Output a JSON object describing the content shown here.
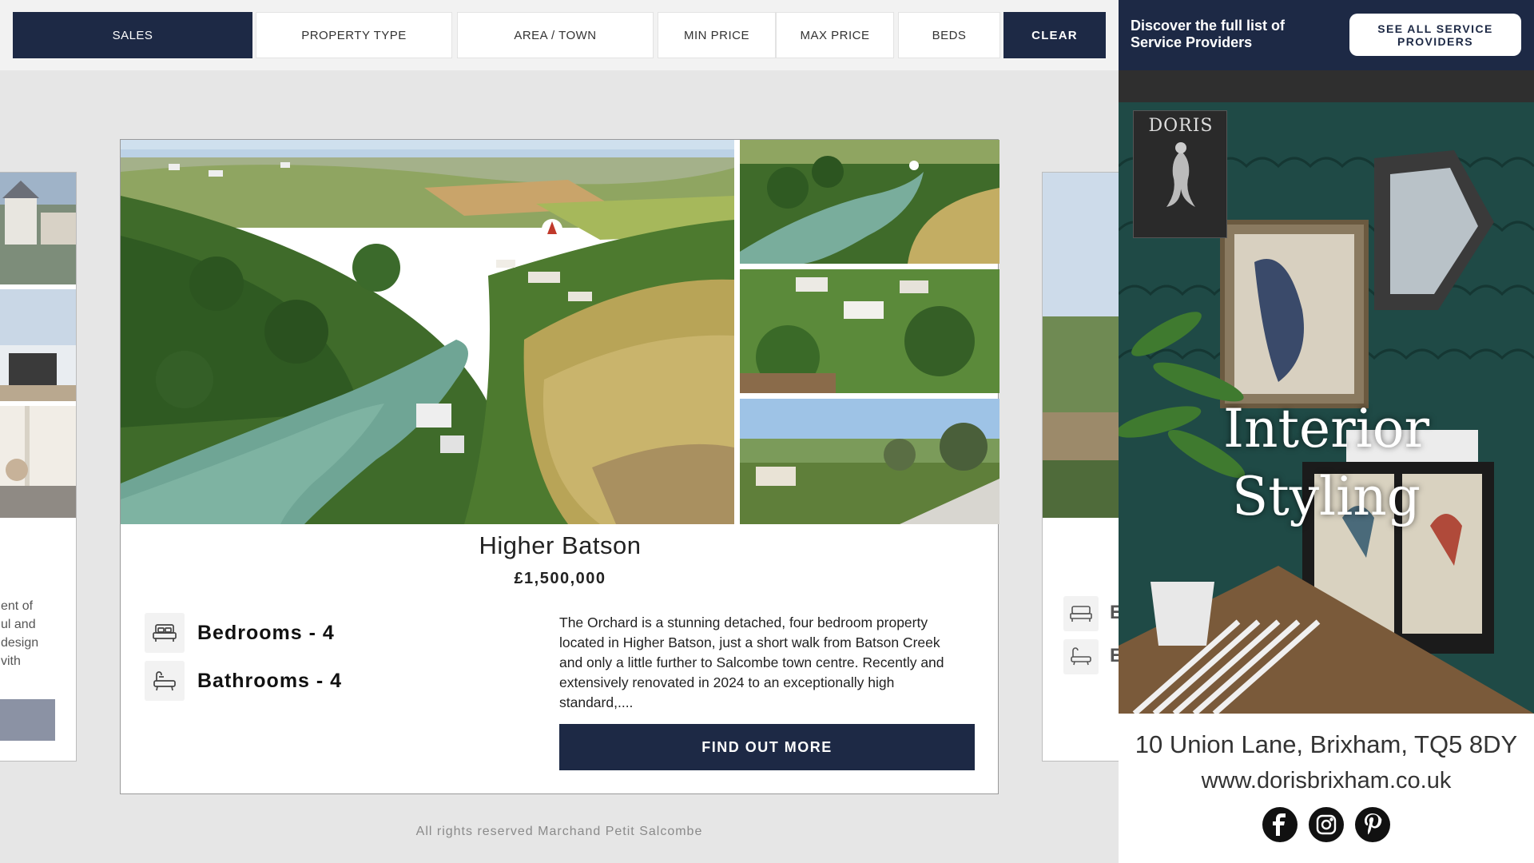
{
  "filters": {
    "sales": "SALES",
    "property_type": "PROPERTY TYPE",
    "area_town": "AREA / TOWN",
    "min_price": "MIN PRICE",
    "max_price": "MAX PRICE",
    "beds": "BEDS",
    "clear": "CLEAR"
  },
  "left_peek": {
    "text_lines": [
      "ent of",
      "ul and",
      "design",
      "vith"
    ]
  },
  "right_peek": {
    "labels": [
      "E",
      "E"
    ]
  },
  "property": {
    "title": "Higher Batson",
    "price": "£1,500,000",
    "bedrooms": "Bedrooms - 4",
    "bathrooms": "Bathrooms - 4",
    "description": "The Orchard is a stunning detached, four bedroom property located in Higher Batson, just a short walk from Batson Creek and only a little further to Salcombe town centre. Recently and extensively renovated in 2024 to an exceptionally high standard,....",
    "cta": "FIND OUT MORE"
  },
  "footer": "All rights reserved Marchand Petit Salcombe",
  "ad": {
    "top_text": "Discover the full list of Service Providers",
    "top_button": "SEE ALL SERVICE PROVIDERS",
    "logo_name": "DORIS",
    "heading_line1": "Interior",
    "heading_line2": "Styling",
    "address": "10 Union Lane, Brixham, TQ5 8DY",
    "url": "www.dorisbrixham.co.uk",
    "social": [
      "facebook-icon",
      "instagram-icon",
      "pinterest-icon"
    ]
  },
  "colors": {
    "navy": "#1d2945",
    "page_bg": "#e6e6e6"
  }
}
